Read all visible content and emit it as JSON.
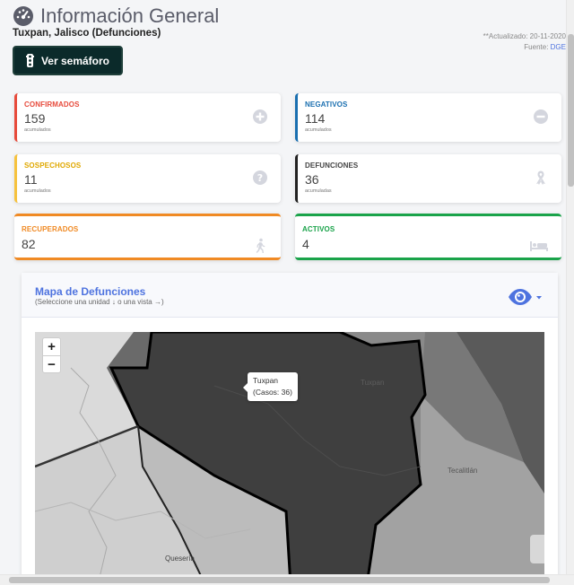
{
  "header": {
    "title": "Información General",
    "subtitle": "Tuxpan, Jalisco (Defunciones)",
    "updated": "**Actualizado: 20-11-2020",
    "source_label": "Fuente:",
    "source_link": "DGE",
    "semaforo_button": "Ver semáforo",
    "icon": "gauge-icon"
  },
  "cards": {
    "confirmados": {
      "label": "CONFIRMADOS",
      "value": "159",
      "sub": "acumulados",
      "color": "#e74a3b",
      "icon": "plus-circle-icon"
    },
    "negativos": {
      "label": "NEGATIVOS",
      "value": "114",
      "sub": "acumulados",
      "color": "#1a6fb0",
      "icon": "minus-circle-icon"
    },
    "sospechosos": {
      "label": "SOSPECHOSOS",
      "value": "11",
      "sub": "acumulados",
      "color": "#f6c23e",
      "icon": "question-circle-icon"
    },
    "defunciones": {
      "label": "DEFUNCIONES",
      "value": "36",
      "sub": "acumuladas",
      "color": "#222222",
      "icon": "ribbon-icon"
    },
    "recuperados": {
      "label": "RECUPERADOS",
      "value": "82",
      "color": "#f08a24",
      "icon": "walking-icon"
    },
    "activos": {
      "label": "ACTIVOS",
      "value": "4",
      "color": "#1aa34a",
      "icon": "bed-icon"
    }
  },
  "map": {
    "title": "Mapa de Defunciones",
    "hint": "(Seleccione una unidad ↓ o una vista →)",
    "zoom_in": "+",
    "zoom_out": "−",
    "tooltip_name": "Tuxpan",
    "tooltip_cases": "(Casos: 36)",
    "places": [
      "Tuxpan",
      "Tecalitlán",
      "Quesería"
    ],
    "eye_icon": "eye-icon"
  }
}
